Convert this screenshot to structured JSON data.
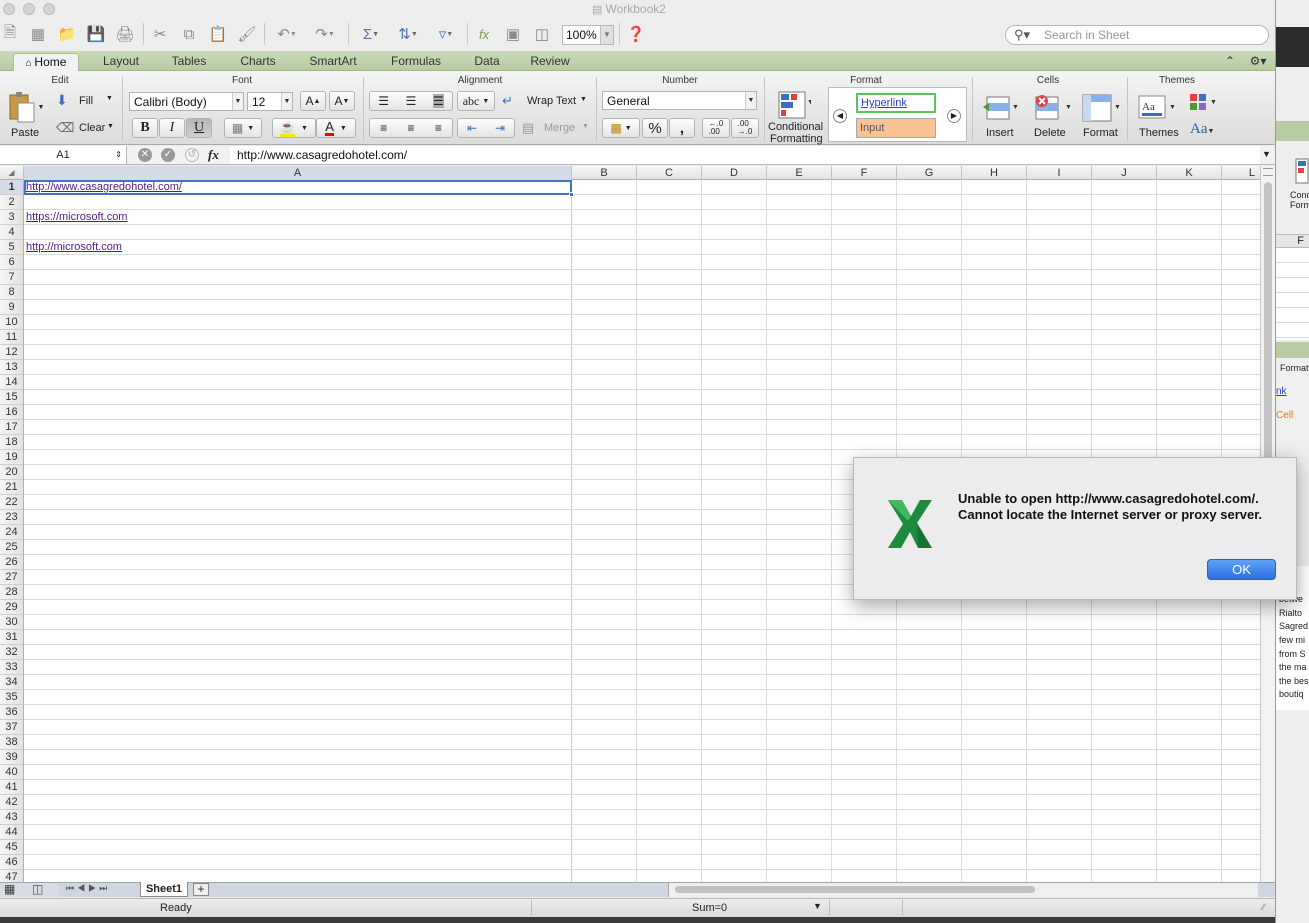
{
  "window": {
    "title": "Workbook2"
  },
  "toolbar": {
    "zoom": "100%",
    "search_placeholder": "Search in Sheet"
  },
  "ribbon_tabs": [
    "Home",
    "Layout",
    "Tables",
    "Charts",
    "SmartArt",
    "Formulas",
    "Data",
    "Review"
  ],
  "ribbon": {
    "groups": {
      "edit": "Edit",
      "font": "Font",
      "alignment": "Alignment",
      "number": "Number",
      "format": "Format",
      "cells": "Cells",
      "themes": "Themes"
    },
    "edit": {
      "paste": "Paste",
      "fill": "Fill",
      "clear": "Clear"
    },
    "font": {
      "name": "Calibri (Body)",
      "size": "12",
      "bold": "B",
      "italic": "I",
      "underline": "U"
    },
    "alignment": {
      "wrap_text": "Wrap Text",
      "merge": "Merge",
      "orientation": "abc"
    },
    "number": {
      "format": "General",
      "percent": "%",
      "comma": ","
    },
    "format": {
      "conditional_line1": "Conditional",
      "conditional_line2": "Formatting",
      "style_hyperlink": "Hyperlink",
      "style_input": "Input"
    },
    "cells": {
      "insert": "Insert",
      "delete": "Delete",
      "format": "Format"
    },
    "themes": {
      "themes": "Themes",
      "fonts": "Aa"
    }
  },
  "formula_bar": {
    "cell_ref": "A1",
    "fx": "fx",
    "content": "http://www.casagredohotel.com/"
  },
  "columns": [
    "A",
    "B",
    "C",
    "D",
    "E",
    "F",
    "G",
    "H",
    "I",
    "J",
    "K",
    "L"
  ],
  "cells": {
    "A1": "http://www.casagredohotel.com/",
    "A3": "https://microsoft.com",
    "A5": "http://microsoft.com"
  },
  "sheet_tabs": [
    "Sheet1"
  ],
  "status": {
    "mode": "Ready",
    "sum": "Sum=0"
  },
  "dialog": {
    "message": "Unable to open http://www.casagredohotel.com/. Cannot locate the Internet server or proxy server.",
    "ok": "OK",
    "icon": "excel-icon"
  },
  "background_window": {
    "column": "F",
    "heading": "Format",
    "cell_text": "Cell",
    "link_fragment": "nk",
    "conditional_fragment": "Cond\nForm",
    "text_fragments": [
      "erlo",
      "tori",
      "betwe",
      "Rialto",
      "Sagred",
      "few mi",
      "from S",
      "the ma",
      "the bes",
      "boutiq"
    ]
  },
  "colors": {
    "accent": "#2a6fe0",
    "ribbon_tab_bar": "#b7cca2",
    "link": "#551a8b",
    "selection": "#3b73c5",
    "excel_green": "#1e8a3c"
  }
}
